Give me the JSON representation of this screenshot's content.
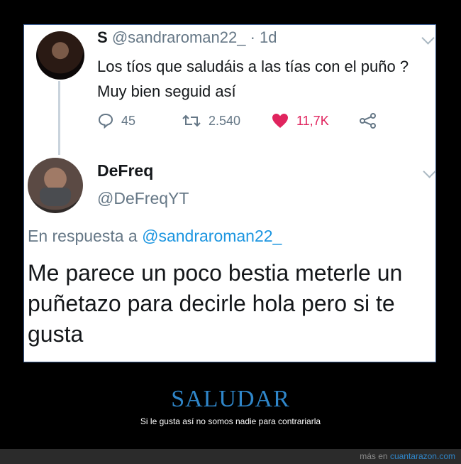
{
  "tweet1": {
    "name": "S",
    "handle": "@sandraroman22_",
    "time": "· 1d",
    "text": "Los tíos que saludáis a las tías con el puño ? Muy bien seguid así",
    "replies": "45",
    "retweets": "2.540",
    "likes": "11,7K"
  },
  "tweet2": {
    "name": "DeFreq",
    "handle": "@DeFreqYT",
    "reply_prefix": "En respuesta a ",
    "reply_handle": "@sandraroman22_",
    "text": "Me parece un poco bestia meterle un puñetazo para decirle hola pero si te gusta"
  },
  "post": {
    "title": "SALUDAR",
    "subtitle": "Si le gusta así no somos nadie para contrariarla"
  },
  "footer": {
    "prefix": "más en ",
    "site": "cuantarazon.com"
  },
  "colors": {
    "like": "#e0245e",
    "link": "#1b95e0",
    "title": "#2f86c9"
  }
}
